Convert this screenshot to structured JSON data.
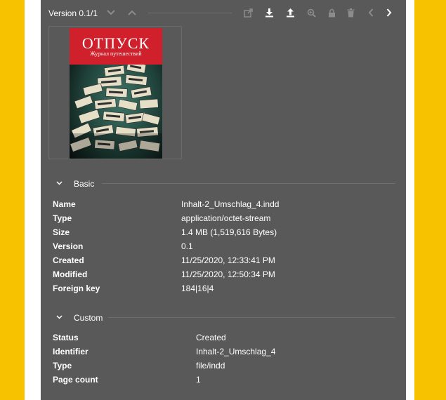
{
  "toolbar": {
    "version_label": "Version 0.1/1",
    "icons": [
      "chevron-down-icon",
      "chevron-up-icon",
      "open-external-icon",
      "download-icon",
      "upload-icon",
      "zoom-in-icon",
      "lock-icon",
      "trash-icon",
      "chevron-left-icon",
      "chevron-right-icon"
    ]
  },
  "thumbnail": {
    "cover_title": "ОТПУСК",
    "cover_subtitle": "Журнал путешествий"
  },
  "basic": {
    "section_label": "Basic",
    "rows": [
      {
        "key": "Name",
        "value": "Inhalt-2_Umschlag_4.indd"
      },
      {
        "key": "Type",
        "value": "application/octet-stream"
      },
      {
        "key": "Size",
        "value": "1.4 MB (1,519,616 Bytes)"
      },
      {
        "key": "Version",
        "value": "0.1"
      },
      {
        "key": "Created",
        "value": "11/25/2020, 12:33:41 PM"
      },
      {
        "key": "Modified",
        "value": "11/25/2020, 12:50:34 PM"
      },
      {
        "key": "Foreign key",
        "value": "184|16|4"
      }
    ]
  },
  "custom": {
    "section_label": "Custom",
    "rows": [
      {
        "key": "Status",
        "value": "Created"
      },
      {
        "key": "Identifier",
        "value": "Inhalt-2_Umschlag_4"
      },
      {
        "key": "Type",
        "value": "file/indd"
      },
      {
        "key": "Page count",
        "value": "1"
      }
    ]
  },
  "colors": {
    "page_background": "#f7c300",
    "panel_background": "#595959",
    "cover_red": "#d0202b"
  }
}
